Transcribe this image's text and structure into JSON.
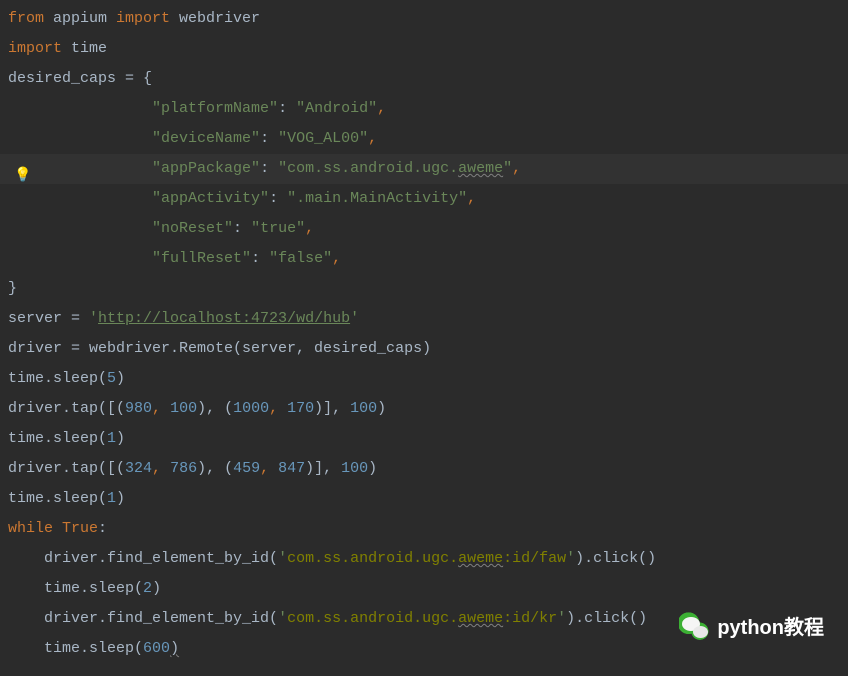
{
  "code": {
    "l1_from": "from",
    "l1_mod": " appium ",
    "l1_import": "import",
    "l1_target": " webdriver",
    "l2_import": "import",
    "l2_target": " time",
    "l3_var": "desired_caps ",
    "l3_eq": "=",
    "l3_brace": " {",
    "l4_indent": "                ",
    "l4_key": "\"platformName\"",
    "l4_colon": ": ",
    "l4_val": "\"Android\"",
    "l4_comma": ",",
    "l5_indent": "                ",
    "l5_key": "\"deviceName\"",
    "l5_colon": ": ",
    "l5_val": "\"VOG_AL00\"",
    "l5_comma": ",",
    "l6_indent": "                ",
    "l6_key": "\"appPackage\"",
    "l6_colon": ": ",
    "l6_val_a": "\"com.ss.android.ugc.",
    "l6_val_b": "aweme",
    "l6_val_c": "\"",
    "l6_comma": ",",
    "l7_indent": "                ",
    "l7_key": "\"appActivity\"",
    "l7_colon": ": ",
    "l7_val": "\".main.MainActivity\"",
    "l7_comma": ",",
    "l8_indent": "                ",
    "l8_key": "\"noReset\"",
    "l8_colon": ": ",
    "l8_val": "\"true\"",
    "l8_comma": ",",
    "l9_indent": "                ",
    "l9_key": "\"fullReset\"",
    "l9_colon": ": ",
    "l9_val": "\"false\"",
    "l9_comma": ",",
    "l10": "}",
    "l11_a": "server = ",
    "l11_q1": "'",
    "l11_url": "http://localhost:4723/wd/hub",
    "l11_q2": "'",
    "l12": "driver = webdriver.Remote(server, desired_caps)",
    "l13_a": "time.sleep(",
    "l13_n": "5",
    "l13_b": ")",
    "l14_a": "driver.tap([(",
    "l14_n1": "980",
    "l14_c1": ", ",
    "l14_n2": "100",
    "l14_c2": "), (",
    "l14_n3": "1000",
    "l14_c3": ", ",
    "l14_n4": "170",
    "l14_c4": ")], ",
    "l14_n5": "100",
    "l14_b": ")",
    "l15_a": "time.sleep(",
    "l15_n": "1",
    "l15_b": ")",
    "l16_a": "driver.tap([(",
    "l16_n1": "324",
    "l16_c1": ", ",
    "l16_n2": "786",
    "l16_c2": "), (",
    "l16_n3": "459",
    "l16_c3": ", ",
    "l16_n4": "847",
    "l16_c4": ")], ",
    "l16_n5": "100",
    "l16_b": ")",
    "l17_a": "time.sleep(",
    "l17_n": "1",
    "l17_b": ")",
    "l18_while": "while ",
    "l18_true": "True",
    "l18_colon": ":",
    "l19_indent": "    ",
    "l19_a": "driver.find_element_by_id(",
    "l19_q1": "'",
    "l19_s1": "com.ss.android.ugc.",
    "l19_s2": "aweme",
    "l19_s3": ":id/faw",
    "l19_q2": "'",
    "l19_b": ").click()",
    "l20_indent": "    ",
    "l20_a": "time.sleep(",
    "l20_n": "2",
    "l20_b": ")",
    "l21_indent": "    ",
    "l21_a": "driver.find_element_by_id(",
    "l21_q1": "'",
    "l21_s1": "com.ss.android.ugc.",
    "l21_s2": "aweme",
    "l21_s3": ":id/kr",
    "l21_q2": "'",
    "l21_b": ").click()",
    "l22_indent": "    ",
    "l22_a": "time.sleep(",
    "l22_n": "600",
    "l22_b": ")"
  },
  "watermark": {
    "text": "python教程"
  }
}
